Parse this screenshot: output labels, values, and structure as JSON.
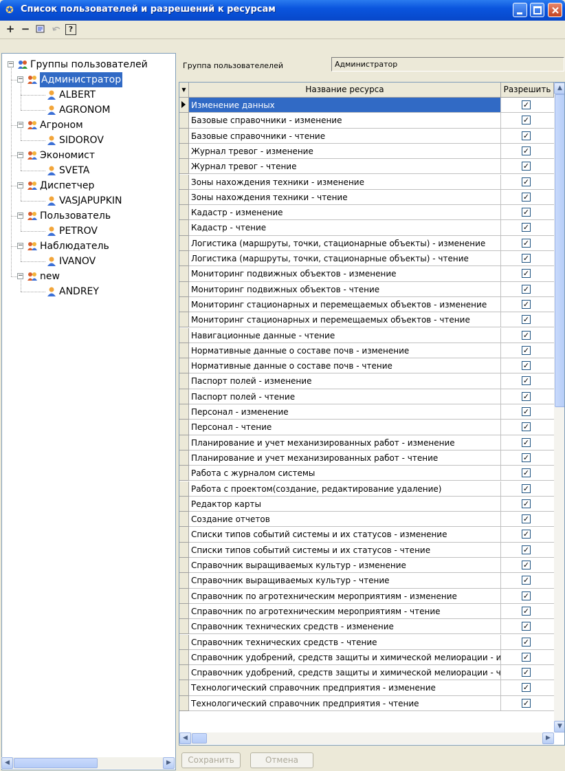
{
  "window": {
    "title": "Список пользователей и разрешений к ресурсам"
  },
  "toolbar": {
    "add": "+",
    "remove": "−",
    "help": "?"
  },
  "tree": {
    "root": "Группы пользователей",
    "groups": [
      {
        "label": "Администратор",
        "selected": true,
        "users": [
          "ALBERT",
          "AGRONOM"
        ]
      },
      {
        "label": "Агроном",
        "users": [
          "SIDOROV"
        ]
      },
      {
        "label": "Экономист",
        "users": [
          "SVETA"
        ]
      },
      {
        "label": "Диспетчер",
        "users": [
          "VASJAPUPKIN"
        ]
      },
      {
        "label": "Пользователь",
        "users": [
          "PETROV"
        ]
      },
      {
        "label": "Наблюдатель",
        "users": [
          "IVANOV"
        ]
      },
      {
        "label": "new",
        "users": [
          "ANDREY"
        ]
      }
    ]
  },
  "right": {
    "group_label": "Группа пользователелей",
    "group_value": "Администратор",
    "col_name": "Название ресурса",
    "col_allow": "Разрешить",
    "save_button": "Сохранить",
    "cancel_button": "Отмена"
  },
  "resources": [
    "Изменение данных",
    "Базовые справочники - изменение",
    "Базовые справочники - чтение",
    "Журнал тревог - изменение",
    "Журнал тревог - чтение",
    "Зоны нахождения техники - изменение",
    "Зоны нахождения техники - чтение",
    "Кадастр - изменение",
    "Кадастр - чтение",
    "Логистика (маршруты, точки, стационарные объекты) - изменение",
    "Логистика (маршруты, точки, стационарные объекты) - чтение",
    "Мониторинг подвижных объектов - изменение",
    "Мониторинг подвижных объектов - чтение",
    "Мониторинг стационарных и перемещаемых объектов - изменение",
    "Мониторинг стационарных и перемещаемых объектов - чтение",
    "Навигационные данные - чтение",
    "Нормативные данные о составе почв - изменение",
    "Нормативные данные о составе почв - чтение",
    "Паспорт полей - изменение",
    "Паспорт полей - чтение",
    "Персонал - изменение",
    "Персонал - чтение",
    "Планирование и учет механизированных работ - изменение",
    "Планирование и учет механизированных работ - чтение",
    "Работа с журналом системы",
    "Работа с проектом(создание, редактирование удаление)",
    "Редактор карты",
    "Создание отчетов",
    "Списки типов событий системы и их статусов - изменение",
    "Списки типов событий системы и их статусов - чтение",
    "Справочник выращиваемых культур - изменение",
    "Справочник выращиваемых культур - чтение",
    "Справочник по агротехническим мероприятиям - изменение",
    "Справочник по агротехническим мероприятиям - чтение",
    "Справочник технических средств - изменение",
    "Справочник технических средств - чтение",
    "Справочник удобрений, средств защиты и химической мелиорации - из",
    "Справочник удобрений, средств защиты и химической мелиорации - чт",
    "Технологический справочник предприятия - изменение",
    "Технологический справочник предприятия - чтение"
  ],
  "allowed": [
    true,
    true,
    true,
    true,
    true,
    true,
    true,
    true,
    true,
    true,
    true,
    true,
    true,
    true,
    true,
    true,
    true,
    true,
    true,
    true,
    true,
    true,
    true,
    true,
    true,
    true,
    true,
    true,
    true,
    true,
    true,
    true,
    true,
    true,
    true,
    true,
    true,
    true,
    true,
    true
  ],
  "colors": {
    "title_bar": "#0a55de",
    "selection": "#316ac5",
    "window_bg": "#ece9d8"
  }
}
